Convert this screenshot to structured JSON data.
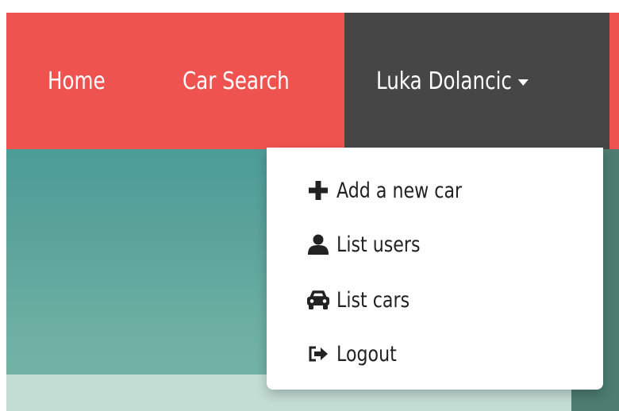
{
  "navbar": {
    "home_label": "Home",
    "search_label": "Car Search",
    "user_label": "Luka Dolancic",
    "colors": {
      "bar": "#ef5350",
      "user_box": "#464646",
      "text": "#ffffff"
    }
  },
  "dropdown": {
    "items": [
      {
        "label": "Add a new car",
        "icon": "plus-icon"
      },
      {
        "label": "List users",
        "icon": "user-icon"
      },
      {
        "label": "List cars",
        "icon": "car-icon"
      },
      {
        "label": "Logout",
        "icon": "logout-icon"
      }
    ]
  },
  "colors": {
    "hero_teal": "#5ca39b",
    "hero_light": "#c3ddd4",
    "hero_strip": "#4d7d70",
    "menu_text": "#222222"
  }
}
